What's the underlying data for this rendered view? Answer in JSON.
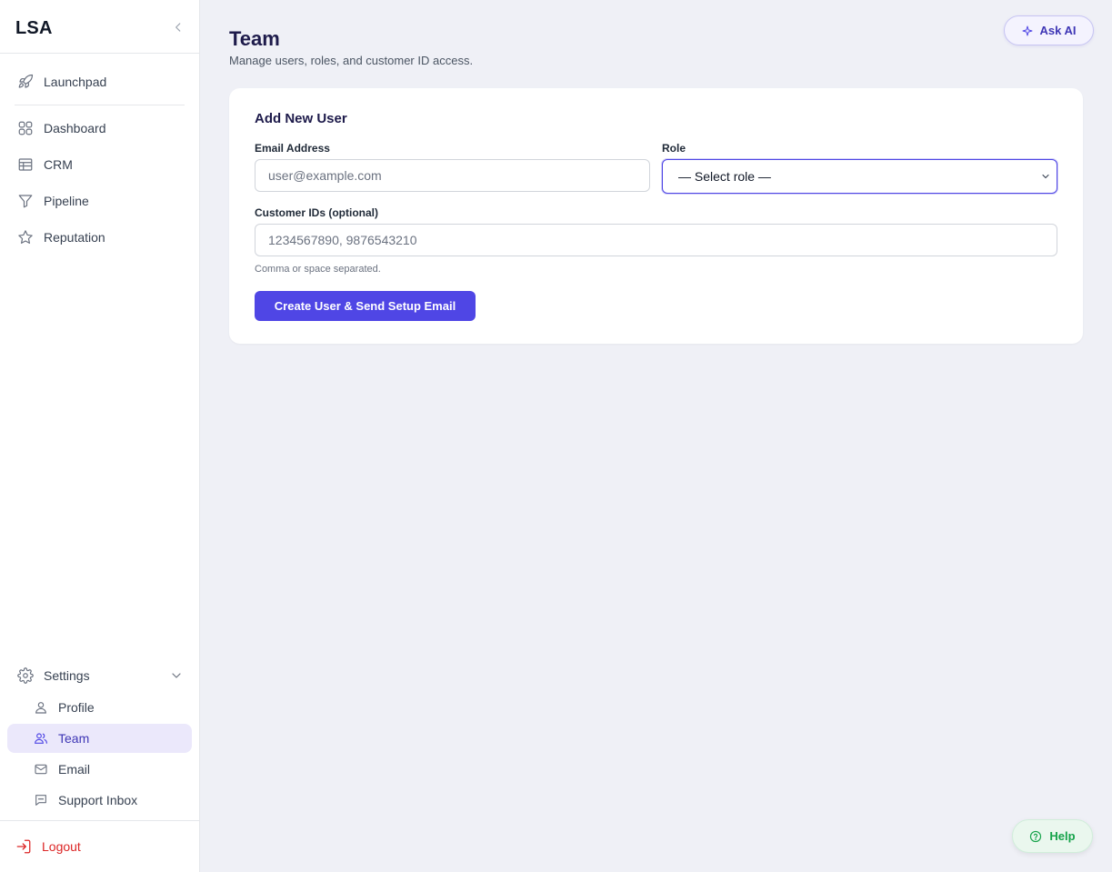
{
  "sidebar": {
    "brand": "LSA",
    "items": [
      {
        "label": "Launchpad",
        "icon": "rocket-icon"
      },
      {
        "label": "Dashboard",
        "icon": "grid-icon"
      },
      {
        "label": "CRM",
        "icon": "table-icon"
      },
      {
        "label": "Pipeline",
        "icon": "funnel-icon"
      },
      {
        "label": "Reputation",
        "icon": "star-icon"
      }
    ],
    "settings": {
      "label": "Settings",
      "icon": "gear-icon",
      "children": [
        {
          "label": "Profile",
          "icon": "user-icon"
        },
        {
          "label": "Team",
          "icon": "users-icon",
          "active": true
        },
        {
          "label": "Email",
          "icon": "mail-icon"
        },
        {
          "label": "Support Inbox",
          "icon": "chat-icon"
        }
      ]
    },
    "logout_label": "Logout"
  },
  "header": {
    "title": "Team",
    "subtitle": "Manage users, roles, and customer ID access.",
    "ask_ai_label": "Ask AI"
  },
  "form": {
    "title": "Add New User",
    "email_label": "Email Address",
    "email_placeholder": "user@example.com",
    "role_label": "Role",
    "role_selected": "— Select role —",
    "customer_ids_label": "Customer IDs (optional)",
    "customer_ids_placeholder": "1234567890, 9876543210",
    "customer_ids_hint": "Comma or space separated.",
    "submit_label": "Create User & Send Setup Email"
  },
  "help_label": "Help",
  "colors": {
    "accent": "#4f46e5",
    "active_bg": "#ebe8fb",
    "logout": "#dc2626",
    "help": "#16a34a",
    "page_bg": "#eff0f6"
  }
}
